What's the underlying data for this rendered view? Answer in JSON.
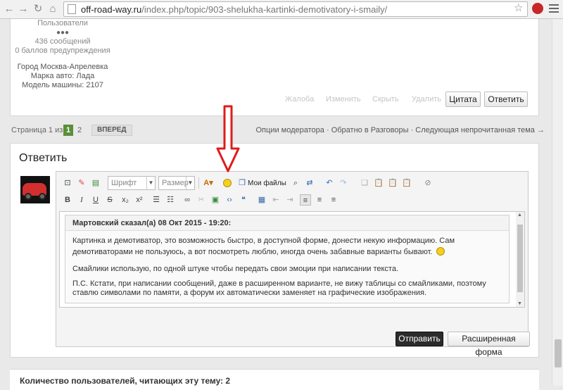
{
  "browser": {
    "url_host": "off-road-way.ru",
    "url_path": "/index.php/topic/903-shelukha-kartinki-demotivatory-i-smaily/"
  },
  "profile": {
    "group": "Пользователи",
    "pips": "●●●",
    "posts": "436 сообщений",
    "warnings": "0 баллов предупреждения",
    "city": "Город Москва-Апрелевка",
    "car_brand": "Марка авто: Лада",
    "car_model": "Модель машины: 2107"
  },
  "post_actions": {
    "report": "Жалоба",
    "edit": "Изменить",
    "hide": "Скрыть",
    "delete": "Удалить",
    "quote": "Цитата",
    "reply": "Ответить"
  },
  "pager": {
    "label": "Страница 1 из 2",
    "current": "1",
    "page2": "2",
    "next": "ВПЕРЕД",
    "mod_options": "Опции модератора",
    "back": "Обратно в Разговоры",
    "next_unread": "Следующая непрочитанная тема",
    "arrow": "→",
    "dot": "·"
  },
  "reply": {
    "title": "Ответить",
    "font_combo": "Шрифт",
    "size_combo": "Размер",
    "my_files": "Мои файлы",
    "quote_header": "Мартовский сказал(а) 08 Окт 2015 - 19:20:",
    "para1": "Картинка и демотиватор, это возможность быстро, в доступной форме, донести некую информацию. Сам демотиваторами не пользуюсь, а вот посмотреть люблю, иногда очень забавные варианты бывают.",
    "para2": "Смайлики использую, по одной штуке чтобы передать свои эмоции при написании текста.",
    "para3": "П.С. Кстати, при написании сообщений, даже в расширенном варианте, не вижу таблицы со смайликами, поэтому ставлю символами по памяти, а форум их автоматически заменяет на графические изображения.",
    "send": "Отправить",
    "advanced": "Расширенная форма"
  },
  "bottom": {
    "text": "Количество пользователей, читающих эту тему: 2"
  },
  "colors": {
    "accent_green": "#5a8f3a",
    "annotation_red": "#e01b1b"
  }
}
